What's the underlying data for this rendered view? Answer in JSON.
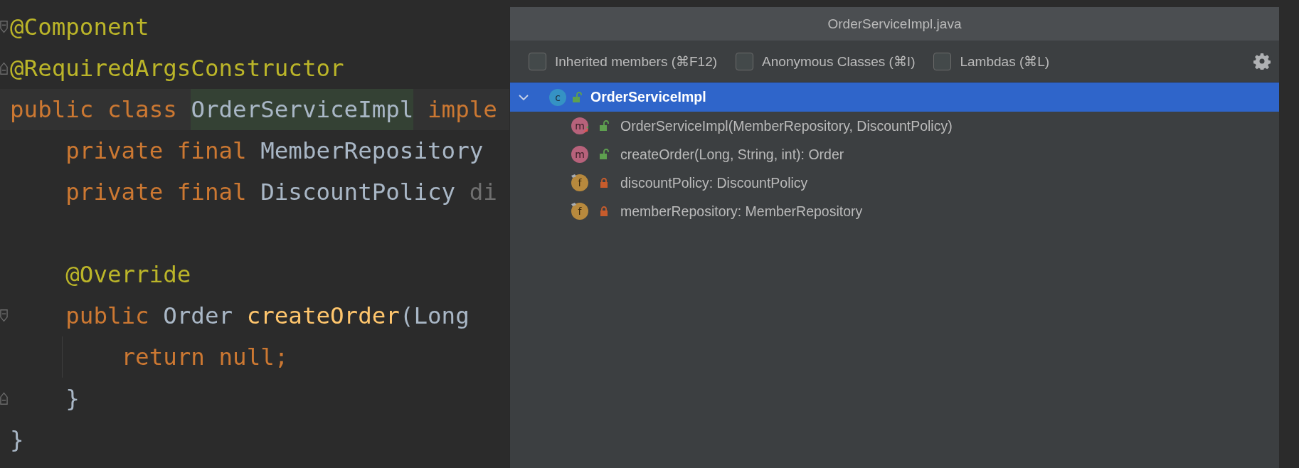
{
  "editor": {
    "lines": [
      {
        "fold_start": true,
        "tokens": [
          {
            "kind": "annotation",
            "text": "@Component"
          }
        ]
      },
      {
        "fold_end": true,
        "tokens": [
          {
            "kind": "annotation",
            "text": "@RequiredArgsConstructor"
          }
        ]
      },
      {
        "current": true,
        "tokens": [
          {
            "kind": "keyword",
            "text": "public class "
          },
          {
            "kind": "usage",
            "text": "OrderServiceImpl"
          },
          {
            "kind": "keyword",
            "text": " imple"
          }
        ]
      },
      {
        "tokens": [
          {
            "kind": "keyword",
            "text": "    private final "
          },
          {
            "kind": "plain",
            "text": "MemberRepository"
          }
        ]
      },
      {
        "tokens": [
          {
            "kind": "keyword",
            "text": "    private final "
          },
          {
            "kind": "plain",
            "text": "DiscountPolicy "
          },
          {
            "kind": "unused",
            "text": "di"
          }
        ]
      },
      {
        "blank_before": true,
        "tokens": [
          {
            "kind": "annotation",
            "text": "    @Override"
          }
        ]
      },
      {
        "fold_start": true,
        "tokens": [
          {
            "kind": "keyword",
            "text": "    public "
          },
          {
            "kind": "plain",
            "text": "Order "
          },
          {
            "kind": "method",
            "text": "createOrder"
          },
          {
            "kind": "plain",
            "text": "(Long"
          }
        ]
      },
      {
        "tokens": [
          {
            "kind": "keyword",
            "text": "        return null;"
          }
        ]
      },
      {
        "fold_end": true,
        "tokens": [
          {
            "kind": "plain",
            "text": "    }"
          }
        ]
      },
      {
        "tokens": [
          {
            "kind": "plain",
            "text": "}"
          }
        ]
      }
    ]
  },
  "structure_popup": {
    "title": "OrderServiceImpl.java",
    "filters": [
      {
        "label": "Inherited members (⌘F12)",
        "checked": false
      },
      {
        "label": "Anonymous Classes (⌘I)",
        "checked": false
      },
      {
        "label": "Lambdas (⌘L)",
        "checked": false
      }
    ],
    "tree": [
      {
        "kind": "class",
        "badge": "c",
        "locked": false,
        "label": "OrderServiceImpl",
        "selected": true,
        "expanded": true,
        "children": [
          {
            "kind": "constructor",
            "badge": "m",
            "locked": false,
            "label": "OrderServiceImpl(MemberRepository, DiscountPolicy)",
            "selected": false
          },
          {
            "kind": "method",
            "badge": "m",
            "locked": false,
            "label": "createOrder(Long, String, int): Order",
            "selected": false
          },
          {
            "kind": "field",
            "badge": "f",
            "locked": true,
            "label": "discountPolicy: DiscountPolicy",
            "selected": false
          },
          {
            "kind": "field",
            "badge": "f",
            "locked": true,
            "label": "memberRepository: MemberRepository",
            "selected": false
          }
        ]
      }
    ]
  }
}
